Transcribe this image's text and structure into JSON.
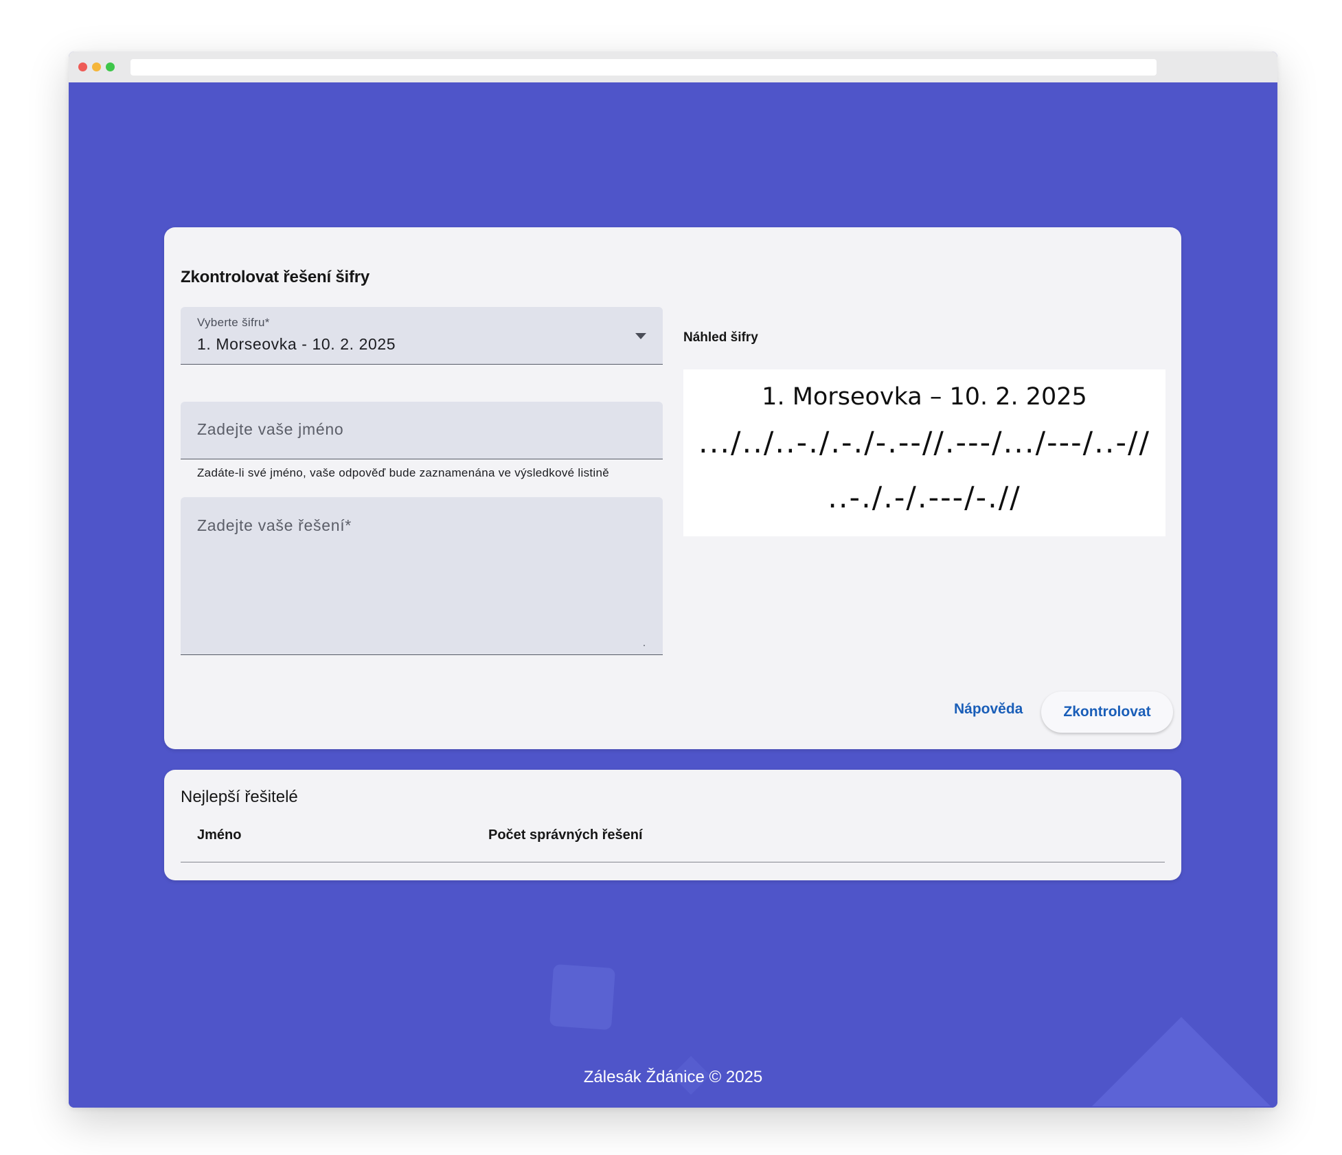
{
  "check_card": {
    "title": "Zkontrolovat řešení šifry",
    "cipher_select": {
      "label": "Vyberte šifru*",
      "value": "1. Morseovka - 10. 2. 2025"
    },
    "name_input": {
      "placeholder": "Zadejte vaše jméno",
      "helper": "Zadáte-li své jméno, vaše odpověď bude zaznamenána ve výsledkové listině"
    },
    "solution_input": {
      "placeholder": "Zadejte vaše řešení*"
    },
    "preview": {
      "heading": "Náhled šifry",
      "title": "1. Morseovka – 10. 2. 2025",
      "line1": ".../../..-./.-./-.--//.---/.../---/..-//",
      "line2": "..-./.-/.---/-.//"
    },
    "buttons": {
      "help": "Nápověda",
      "check": "Zkontrolovat"
    }
  },
  "solvers_card": {
    "title": "Nejlepší řešitelé",
    "columns": [
      "Jméno",
      "Počet správných řešení"
    ]
  },
  "footer": {
    "text": "Zálesák Ždánice © 2025"
  },
  "colors": {
    "background": "#4f55c9",
    "card": "#f3f3f6",
    "accent": "#1a5eb8",
    "field": "#e0e2eb"
  }
}
